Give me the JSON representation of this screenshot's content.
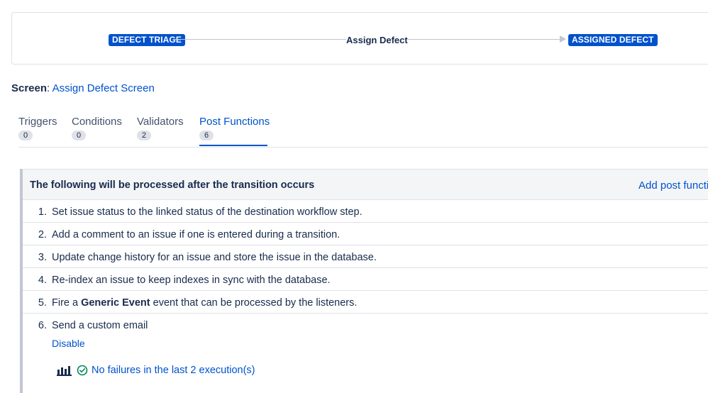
{
  "workflow": {
    "source_status": "DEFECT TRIAGE",
    "transition": "Assign Defect",
    "target_status": "ASSIGNED DEFECT"
  },
  "screen": {
    "label": "Screen",
    "separator": ":",
    "value": "Assign Defect Screen"
  },
  "tabs": [
    {
      "label": "Triggers",
      "count": "0"
    },
    {
      "label": "Conditions",
      "count": "0"
    },
    {
      "label": "Validators",
      "count": "2"
    },
    {
      "label": "Post Functions",
      "count": "6",
      "active": true
    }
  ],
  "panel": {
    "title": "The following will be processed after the transition occurs",
    "add_link": "Add post function",
    "items": [
      {
        "num": "1.",
        "text": "Set issue status to the linked status of the destination workflow step."
      },
      {
        "num": "2.",
        "text": "Add a comment to an issue if one is entered during a transition."
      },
      {
        "num": "3.",
        "text": "Update change history for an issue and store the issue in the database."
      },
      {
        "num": "4.",
        "text": "Re-index an issue to keep indexes in sync with the database."
      },
      {
        "num": "5.",
        "text_before": "Fire a ",
        "bold": "Generic Event",
        "text_after": " event that can be processed by the listeners."
      },
      {
        "num": "6.",
        "text": "Send a custom email",
        "action": "Disable",
        "status": "No failures in the last 2 execution(s)"
      }
    ]
  },
  "colors": {
    "accent": "#0052cc",
    "text": "#172b4d",
    "border": "#dfe1e6",
    "success": "#00875a"
  },
  "icons": [
    "bar-chart-icon",
    "check-circle-icon",
    "arrow-right-icon"
  ]
}
